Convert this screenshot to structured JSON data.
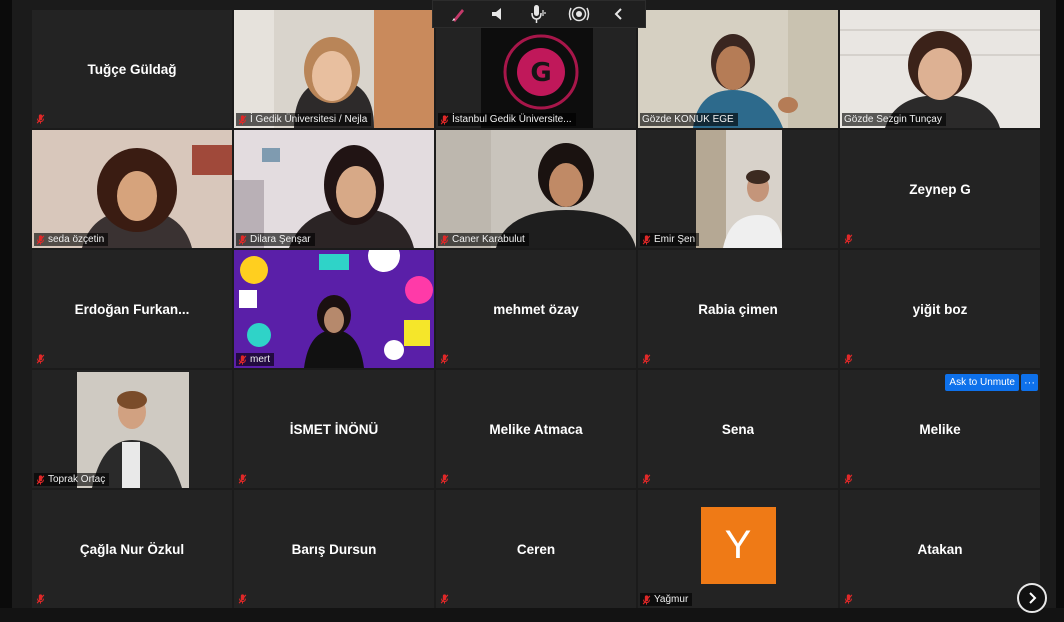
{
  "toolbar": {
    "icons": [
      "annotate-icon",
      "speaker-icon",
      "microphone-icon",
      "broadcast-icon",
      "collapse-chevron-icon"
    ]
  },
  "participants": {
    "p01": {
      "name": "Tuğçe Güldağ"
    },
    "p02": {
      "label": "İ Gedik Üniversitesi / Nejla"
    },
    "p03": {
      "label": "İstanbul Gedik Üniversite..."
    },
    "p04": {
      "label": "Gözde KONUK EGE"
    },
    "p05": {
      "label": "Gözde Sezgin Tunçay"
    },
    "p06": {
      "label": "seda özçetin"
    },
    "p07": {
      "label": "Dilara Şenşar"
    },
    "p08": {
      "label": "Caner Karabulut"
    },
    "p09": {
      "label": "Emir Şen"
    },
    "p10": {
      "name": "Zeynep G"
    },
    "p11": {
      "name": "Erdoğan Furkan..."
    },
    "p12": {
      "label": "mert"
    },
    "p13": {
      "name": "mehmet özay"
    },
    "p14": {
      "name": "Rabia çimen"
    },
    "p15": {
      "name": "yiğit boz"
    },
    "p16": {
      "label": "Toprak Ortaç"
    },
    "p17": {
      "name": "İSMET İNÖNÜ"
    },
    "p18": {
      "name": "Melike Atmaca"
    },
    "p19": {
      "name": "Sena"
    },
    "p20": {
      "name": "Melike",
      "unmute_label": "Ask to Unmute",
      "more_label": "···"
    },
    "p21": {
      "name": "Çağla Nur Özkul"
    },
    "p22": {
      "name": "Barış Dursun"
    },
    "p23": {
      "name": "Ceren"
    },
    "p24": {
      "label": "Yağmur",
      "initial": "Y"
    },
    "p25": {
      "name": "Atakan"
    }
  },
  "colors": {
    "tile_bg": "#232323",
    "active_border": "#b7dd5a",
    "muted_red": "#e02828",
    "unmute_blue": "#0e71eb",
    "avatar_orange": "#ef7a16"
  }
}
